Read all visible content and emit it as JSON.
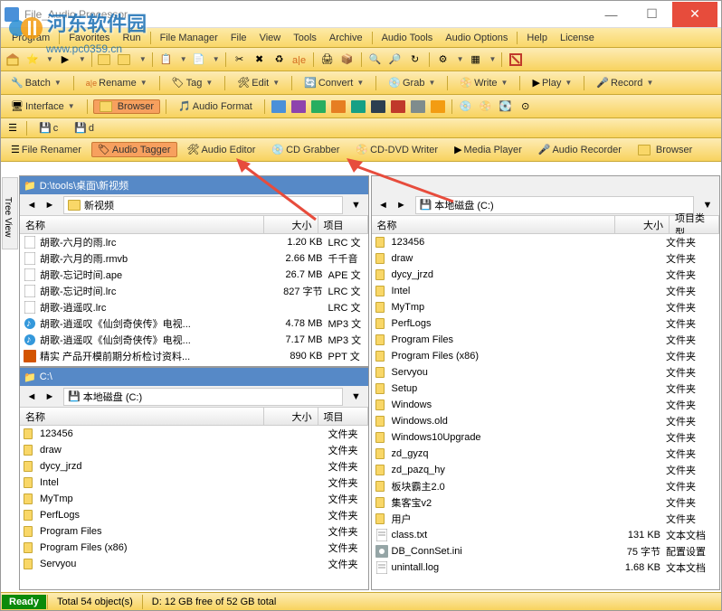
{
  "window": {
    "title": "File_Audio Processor",
    "watermark_text": "河东软件园",
    "watermark_url": "www.pc0359.cn"
  },
  "menu": {
    "items": [
      "Program",
      "Favorites",
      "Run",
      "File Manager",
      "File",
      "View",
      "Tools",
      "Archive",
      "Audio Tools",
      "Audio Options",
      "Help",
      "License"
    ]
  },
  "toolbar2": {
    "batch": "Batch",
    "rename": "Rename",
    "tag": "Tag",
    "edit": "Edit",
    "convert": "Convert",
    "grab": "Grab",
    "write": "Write",
    "play": "Play",
    "record": "Record"
  },
  "toolbar3": {
    "interface": "Interface",
    "browser": "Browser",
    "audio_format": "Audio Format"
  },
  "drives": {
    "c": "c",
    "d": "d"
  },
  "tabs": {
    "file_renamer": "File Renamer",
    "audio_tagger": "Audio Tagger",
    "audio_editor": "Audio Editor",
    "cd_grabber": "CD Grabber",
    "cd_dvd_writer": "CD-DVD Writer",
    "media_player": "Media Player",
    "audio_recorder": "Audio Recorder",
    "browser": "Browser"
  },
  "columns": {
    "name": "名称",
    "size": "大小",
    "type": "项目类型",
    "type_short": "项目"
  },
  "left_top": {
    "path": "D:\\tools\\桌面\\新视频",
    "breadcrumb": "新视频",
    "rows": [
      {
        "icon": "file",
        "name": "胡歌-六月的雨.lrc",
        "size": "1.20 KB",
        "type": "LRC 文"
      },
      {
        "icon": "file",
        "name": "胡歌-六月的雨.rmvb",
        "size": "2.66 MB",
        "type": "千千音"
      },
      {
        "icon": "file",
        "name": "胡歌-忘记时间.ape",
        "size": "26.7 MB",
        "type": "APE 文"
      },
      {
        "icon": "file",
        "name": "胡歌-忘记时间.lrc",
        "size": "827 字节",
        "type": "LRC 文"
      },
      {
        "icon": "file",
        "name": "胡歌-逍遥叹.lrc",
        "size": "",
        "type": "LRC 文"
      },
      {
        "icon": "mp3",
        "name": "胡歌-逍遥叹《仙剑奇侠传》电视...",
        "size": "4.78 MB",
        "type": "MP3 文"
      },
      {
        "icon": "mp3",
        "name": "胡歌-逍遥叹《仙剑奇侠传》电视...",
        "size": "7.17 MB",
        "type": "MP3 文"
      },
      {
        "icon": "ppt",
        "name": "精实 产品开模前期分析检讨资料...",
        "size": "890 KB",
        "type": "PPT 文"
      }
    ]
  },
  "left_bottom": {
    "path": "C:\\",
    "breadcrumb": "本地磁盘 (C:)",
    "rows": [
      {
        "icon": "folder",
        "name": "123456",
        "size": "",
        "type": "文件夹"
      },
      {
        "icon": "folder",
        "name": "draw",
        "size": "",
        "type": "文件夹"
      },
      {
        "icon": "folder",
        "name": "dycy_jrzd",
        "size": "",
        "type": "文件夹"
      },
      {
        "icon": "folder",
        "name": "Intel",
        "size": "",
        "type": "文件夹"
      },
      {
        "icon": "folder",
        "name": "MyTmp",
        "size": "",
        "type": "文件夹"
      },
      {
        "icon": "folder",
        "name": "PerfLogs",
        "size": "",
        "type": "文件夹"
      },
      {
        "icon": "folder",
        "name": "Program Files",
        "size": "",
        "type": "文件夹"
      },
      {
        "icon": "folder",
        "name": "Program Files (x86)",
        "size": "",
        "type": "文件夹"
      },
      {
        "icon": "folder",
        "name": "Servyou",
        "size": "",
        "type": "文件夹"
      }
    ]
  },
  "right": {
    "breadcrumb": "本地磁盘 (C:)",
    "rows": [
      {
        "icon": "folder",
        "name": "123456",
        "size": "",
        "type": "文件夹"
      },
      {
        "icon": "folder",
        "name": "draw",
        "size": "",
        "type": "文件夹"
      },
      {
        "icon": "folder",
        "name": "dycy_jrzd",
        "size": "",
        "type": "文件夹"
      },
      {
        "icon": "folder",
        "name": "Intel",
        "size": "",
        "type": "文件夹"
      },
      {
        "icon": "folder",
        "name": "MyTmp",
        "size": "",
        "type": "文件夹"
      },
      {
        "icon": "folder",
        "name": "PerfLogs",
        "size": "",
        "type": "文件夹"
      },
      {
        "icon": "folder",
        "name": "Program Files",
        "size": "",
        "type": "文件夹"
      },
      {
        "icon": "folder",
        "name": "Program Files (x86)",
        "size": "",
        "type": "文件夹"
      },
      {
        "icon": "folder",
        "name": "Servyou",
        "size": "",
        "type": "文件夹"
      },
      {
        "icon": "folder",
        "name": "Setup",
        "size": "",
        "type": "文件夹"
      },
      {
        "icon": "folder",
        "name": "Windows",
        "size": "",
        "type": "文件夹"
      },
      {
        "icon": "folder",
        "name": "Windows.old",
        "size": "",
        "type": "文件夹"
      },
      {
        "icon": "folder",
        "name": "Windows10Upgrade",
        "size": "",
        "type": "文件夹"
      },
      {
        "icon": "folder",
        "name": "zd_gyzq",
        "size": "",
        "type": "文件夹"
      },
      {
        "icon": "folder",
        "name": "zd_pazq_hy",
        "size": "",
        "type": "文件夹"
      },
      {
        "icon": "folder",
        "name": "板块霸主2.0",
        "size": "",
        "type": "文件夹"
      },
      {
        "icon": "folder",
        "name": "集客宝v2",
        "size": "",
        "type": "文件夹"
      },
      {
        "icon": "folder",
        "name": "用户",
        "size": "",
        "type": "文件夹"
      },
      {
        "icon": "txt",
        "name": "class.txt",
        "size": "131 KB",
        "type": "文本文档"
      },
      {
        "icon": "ini",
        "name": "DB_ConnSet.ini",
        "size": "75 字节",
        "type": "配置设置"
      },
      {
        "icon": "txt",
        "name": "unintall.log",
        "size": "1.68 KB",
        "type": "文本文档"
      }
    ]
  },
  "status": {
    "ready": "Ready",
    "count": "Total 54 object(s)",
    "space": "D:   12 GB free of 52 GB total"
  },
  "side_tab": "Tree View"
}
